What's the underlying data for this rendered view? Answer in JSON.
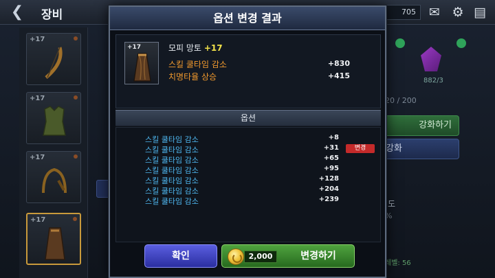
{
  "header": {
    "back_icon": "chevron-left-icon",
    "title": "장비",
    "currency_value": "705",
    "icons": [
      "mail-icon",
      "gear-icon",
      "chat-icon"
    ]
  },
  "equipment_slots": [
    {
      "level": "+17",
      "item": "bow"
    },
    {
      "level": "+17",
      "item": "armor"
    },
    {
      "level": "+17",
      "item": "helmet"
    },
    {
      "level": "+17",
      "item": "cape"
    }
  ],
  "background_right": {
    "count_text": "882/3",
    "progress_text": "20 / 200",
    "enhance_button": "강화하기",
    "upgrade_button": "강화",
    "label": "도",
    "percent_text": "%",
    "footer_text": "레벨: 56"
  },
  "dialog": {
    "title": "옵션 변경 결과",
    "item": {
      "icon_level": "+17",
      "name": "모피 망토",
      "level": "+17",
      "stats": [
        {
          "name": "스킬 쿨타임 감소",
          "value": "+830"
        },
        {
          "name": "치명타율 상승",
          "value": "+415"
        }
      ]
    },
    "options_header": "옵션",
    "options": [
      {
        "name": "스킬 쿨타임 감소",
        "value": "+8",
        "badge": ""
      },
      {
        "name": "스킬 쿨타임 감소",
        "value": "+31",
        "badge": "변경"
      },
      {
        "name": "스킬 쿨타임 감소",
        "value": "+65",
        "badge": ""
      },
      {
        "name": "스킬 쿨타임 감소",
        "value": "+95",
        "badge": ""
      },
      {
        "name": "스킬 쿨타임 감소",
        "value": "+128",
        "badge": ""
      },
      {
        "name": "스킬 쿨타임 감소",
        "value": "+204",
        "badge": ""
      },
      {
        "name": "스킬 쿨타임 감소",
        "value": "+239",
        "badge": ""
      }
    ],
    "confirm_label": "확인",
    "change_cost": "2,000",
    "change_label": "변경하기",
    "coin_icon": "gold-coin-icon"
  },
  "colors": {
    "option_text": "#4fb9f2",
    "stat_text": "#f29a2e",
    "level_text": "#f2e24a",
    "badge": "#c42a2a"
  }
}
